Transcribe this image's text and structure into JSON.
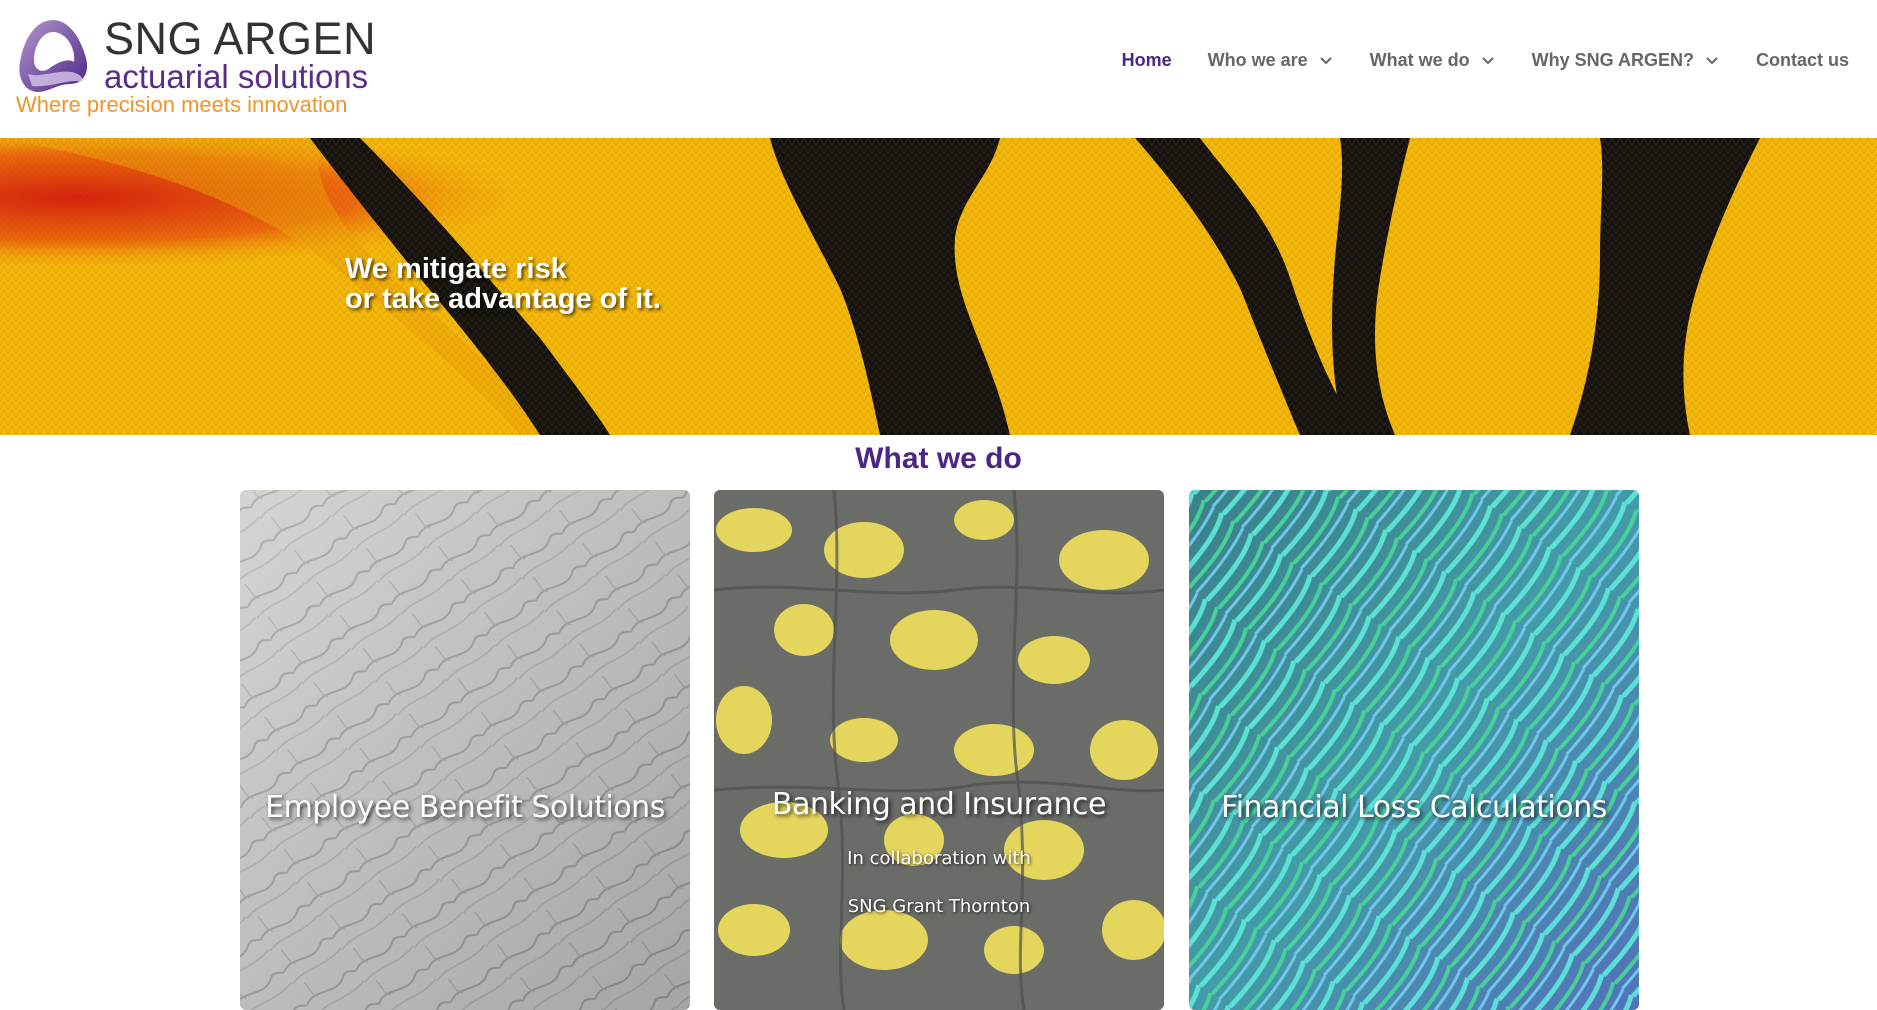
{
  "brand": {
    "title": "SNG ARGEN",
    "subtitle": "actuarial solutions",
    "tagline": "Where precision meets innovation",
    "colors": {
      "purple": "#4b2684",
      "orange": "#f0942a",
      "text": "#333333"
    }
  },
  "nav": {
    "items": [
      {
        "label": "Home",
        "active": true,
        "dropdown": false
      },
      {
        "label": "Who we are",
        "active": false,
        "dropdown": true
      },
      {
        "label": "What we do",
        "active": false,
        "dropdown": true
      },
      {
        "label": "Why SNG ARGEN?",
        "active": false,
        "dropdown": true
      },
      {
        "label": "Contact us",
        "active": false,
        "dropdown": false
      }
    ]
  },
  "hero": {
    "line1": "We mitigate risk",
    "line2": "or take advantage of it."
  },
  "section": {
    "title": "What we do"
  },
  "cards": [
    {
      "title": "Employee Benefit Solutions",
      "image": "elephant-skin-texture"
    },
    {
      "title": "Banking and Insurance",
      "line1": "In collaboration with",
      "line2": "SNG Grant Thornton",
      "image": "yellow-black-reptile-skin"
    },
    {
      "title": "Financial Loss Calculations",
      "image": "iridescent-feathers"
    }
  ]
}
